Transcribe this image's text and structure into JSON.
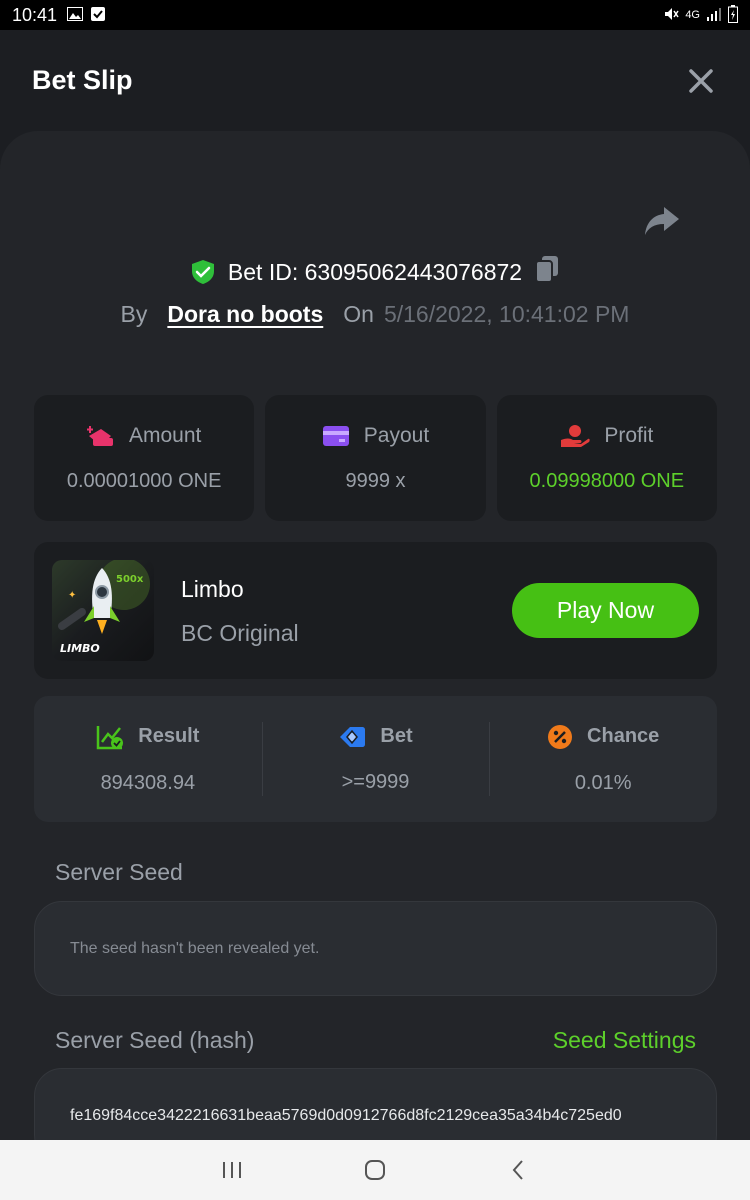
{
  "status_bar": {
    "time": "10:41",
    "network": "4G"
  },
  "header": {
    "title": "Bet Slip"
  },
  "bet": {
    "id_text": "Bet ID: 63095062443076872",
    "by_label": "By",
    "user": "Dora no boots",
    "on_label": "On",
    "date": "5/16/2022, 10:41:02 PM"
  },
  "stats": [
    {
      "label": "Amount",
      "value": "0.00001000 ONE",
      "icon": "amount-icon",
      "color": "#e8336b"
    },
    {
      "label": "Payout",
      "value": "9999 x",
      "icon": "payout-card-icon",
      "color": "#8b4ff0"
    },
    {
      "label": "Profit",
      "value": "0.09998000 ONE",
      "icon": "profit-hand-icon",
      "color": "#e23b3b"
    }
  ],
  "game": {
    "name": "Limbo",
    "subtitle": "BC Original",
    "thumb_label": "LIMBO",
    "thumb_badge": "500x",
    "play_label": "Play Now"
  },
  "results": [
    {
      "label": "Result",
      "value": "894308.94",
      "icon": "result-chart-icon",
      "color": "#49c41b"
    },
    {
      "label": "Bet",
      "value": ">=9999",
      "icon": "bet-tag-icon",
      "color": "#2b7af0"
    },
    {
      "label": "Chance",
      "value": "0.01%",
      "icon": "chance-percent-icon",
      "color": "#f07a1a"
    }
  ],
  "server_seed": {
    "label": "Server Seed",
    "note": "The seed hasn't been revealed yet."
  },
  "server_seed_hash": {
    "label": "Server Seed (hash)",
    "settings_link": "Seed Settings",
    "hash": "fe169f84cce3422216631beaa5769d0d0912766d8fc2129cea35a34b4c725ed0"
  },
  "colors": {
    "accent_green": "#46c014",
    "profit_green": "#5dd02b",
    "background": "#1c1e22",
    "card": "#232529"
  }
}
